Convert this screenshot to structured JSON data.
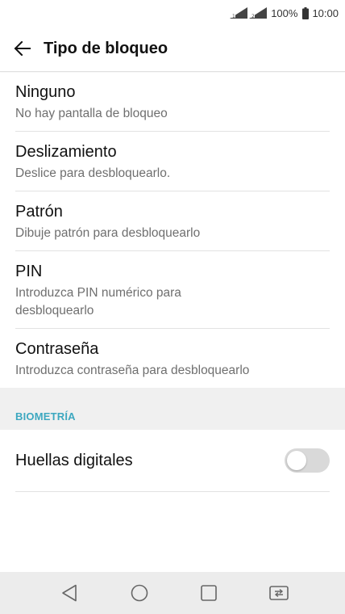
{
  "status_bar": {
    "battery_percent": "100%",
    "time": "10:00"
  },
  "app_bar": {
    "title": "Tipo de bloqueo"
  },
  "lock_options": [
    {
      "title": "Ninguno",
      "subtitle": "No hay pantalla de bloqueo"
    },
    {
      "title": "Deslizamiento",
      "subtitle": "Deslice para desbloquearlo."
    },
    {
      "title": "Patrón",
      "subtitle": "Dibuje patrón para desbloquearlo"
    },
    {
      "title": "PIN",
      "subtitle": "Introduzca PIN numérico para desbloquearlo"
    },
    {
      "title": "Contraseña",
      "subtitle": "Introduzca contraseña para desbloquearlo"
    }
  ],
  "biometrics": {
    "section_label": "BIOMETRÍA",
    "fingerprint_label": "Huellas digitales",
    "fingerprint_enabled": false
  },
  "colors": {
    "section_header": "#3da8c0",
    "toggle_off": "#d9d9d9",
    "nav_background": "#ececec"
  },
  "icons": {
    "back": "arrow-left-icon",
    "nav_back": "triangle-back-icon",
    "nav_home": "circle-home-icon",
    "nav_recents": "square-recents-icon",
    "nav_switch": "dual-window-icon"
  }
}
